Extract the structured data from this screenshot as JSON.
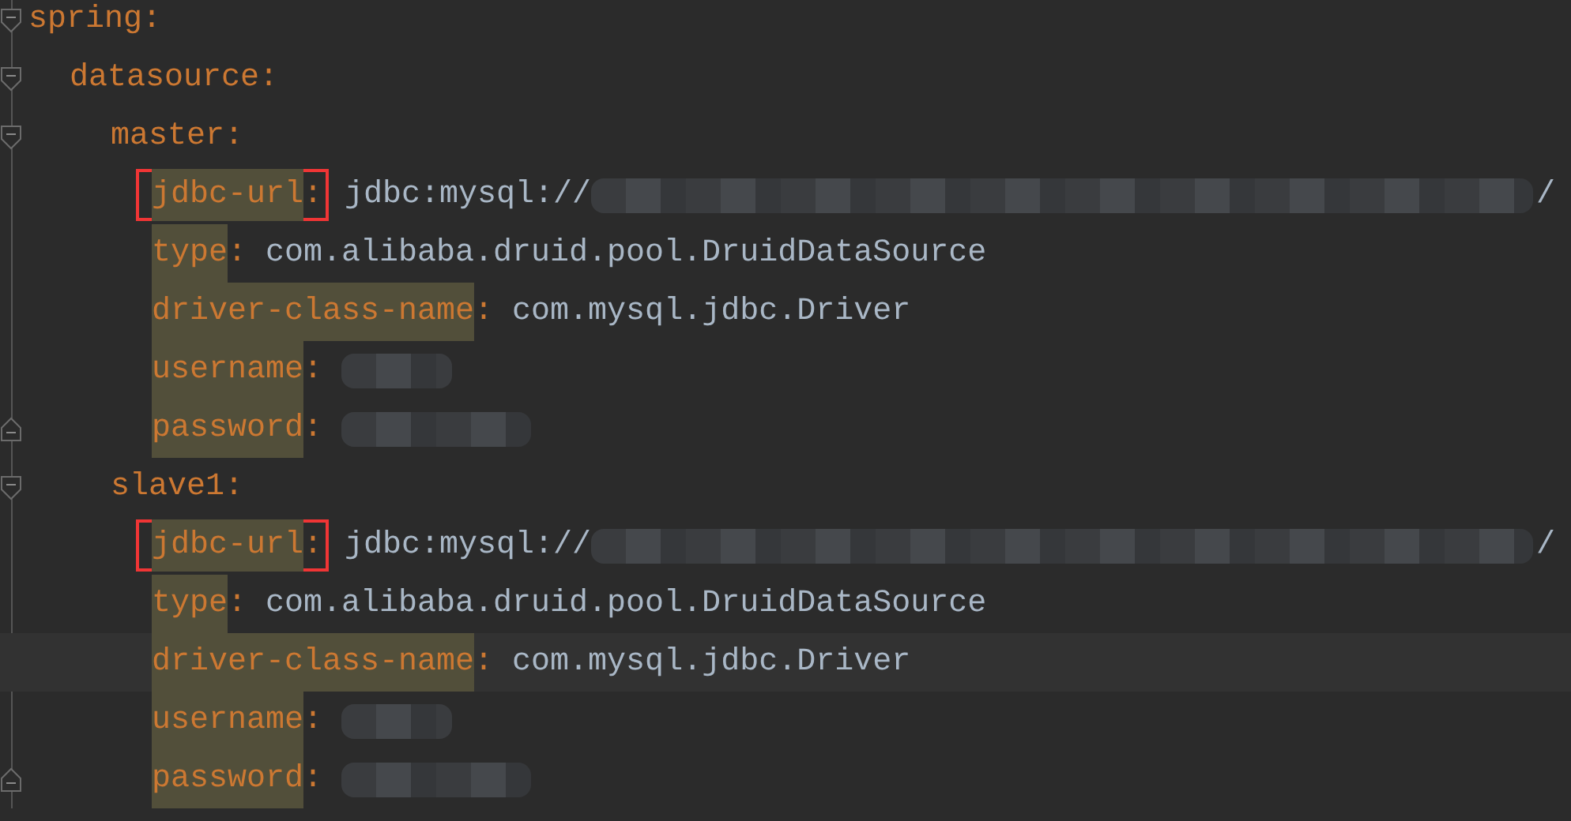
{
  "editor": {
    "lines": [
      {
        "kind": "section",
        "key": "spring:",
        "highlighted": false,
        "boxed": false,
        "current": false,
        "fold_start": true,
        "fold_end": false,
        "children": [
          {
            "kind": "section",
            "key": "datasource:",
            "highlighted": false,
            "boxed": false,
            "current": false,
            "fold_start": true,
            "fold_end": false,
            "children": [
              {
                "kind": "section",
                "key": "master:",
                "highlighted": false,
                "boxed": false,
                "current": false,
                "fold_start": true,
                "fold_end": false,
                "children": [
                  {
                    "kind": "url",
                    "key": "jdbc-url:",
                    "value": "jdbc:mysql://",
                    "value_end": "/",
                    "highlighted": true,
                    "boxed": true,
                    "current": false,
                    "fold_start": false,
                    "fold_end": false
                  },
                  {
                    "kind": "pair",
                    "key": "type:",
                    "value": "com.alibaba.druid.pool.DruidDataSource",
                    "highlighted": true,
                    "boxed": false,
                    "current": false,
                    "fold_start": false,
                    "fold_end": false
                  },
                  {
                    "kind": "pair",
                    "key": "driver-class-name:",
                    "value": "com.mysql.jdbc.Driver",
                    "highlighted": true,
                    "boxed": false,
                    "current": false,
                    "fold_start": false,
                    "fold_end": false
                  },
                  {
                    "kind": "user",
                    "key": "username:",
                    "highlighted": true,
                    "boxed": false,
                    "current": false,
                    "fold_start": false,
                    "fold_end": false
                  },
                  {
                    "kind": "secret",
                    "key": "password:",
                    "highlighted": true,
                    "boxed": false,
                    "current": false,
                    "fold_start": false,
                    "fold_end": true
                  }
                ]
              },
              {
                "kind": "section",
                "key": "slave1:",
                "highlighted": false,
                "boxed": false,
                "current": false,
                "fold_start": true,
                "fold_end": false,
                "children": [
                  {
                    "kind": "url",
                    "key": "jdbc-url:",
                    "value": "jdbc:mysql://",
                    "value_end": "/",
                    "highlighted": true,
                    "boxed": true,
                    "current": false,
                    "fold_start": false,
                    "fold_end": false
                  },
                  {
                    "kind": "pair",
                    "key": "type:",
                    "value": "com.alibaba.druid.pool.DruidDataSource",
                    "highlighted": true,
                    "boxed": false,
                    "current": false,
                    "fold_start": false,
                    "fold_end": false
                  },
                  {
                    "kind": "pair",
                    "key": "driver-class-name:",
                    "value": "com.mysql.jdbc.Driver",
                    "highlighted": true,
                    "boxed": false,
                    "current": true,
                    "fold_start": false,
                    "fold_end": false
                  },
                  {
                    "kind": "user",
                    "key": "username:",
                    "highlighted": true,
                    "boxed": false,
                    "current": false,
                    "fold_start": false,
                    "fold_end": false
                  },
                  {
                    "kind": "secret",
                    "key": "password:",
                    "highlighted": true,
                    "boxed": false,
                    "current": false,
                    "fold_start": false,
                    "fold_end": true
                  }
                ]
              }
            ]
          }
        ]
      }
    ]
  }
}
